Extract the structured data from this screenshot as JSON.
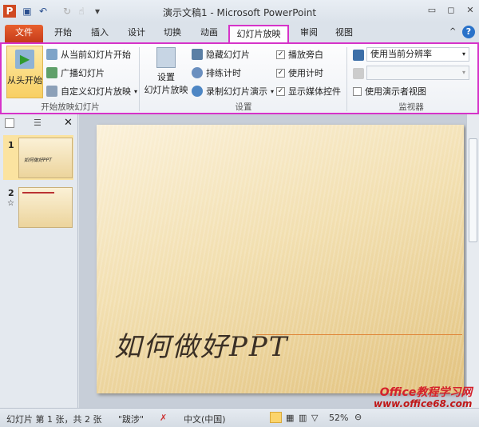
{
  "window": {
    "title": "演示文稿1 - Microsoft PowerPoint",
    "app_icon": "P"
  },
  "tabs": [
    {
      "label": "文件"
    },
    {
      "label": "开始"
    },
    {
      "label": "插入"
    },
    {
      "label": "设计"
    },
    {
      "label": "切换"
    },
    {
      "label": "动画"
    },
    {
      "label": "幻灯片放映",
      "active": true
    },
    {
      "label": "审阅"
    },
    {
      "label": "视图"
    }
  ],
  "ribbon": {
    "group1": {
      "label": "开始放映幻灯片",
      "from_start": "从头开始",
      "from_current": "从当前幻灯片开始",
      "broadcast": "广播幻灯片",
      "custom": "自定义幻灯片放映"
    },
    "group2": {
      "label": "设置",
      "setup_line1": "设置",
      "setup_line2": "幻灯片放映",
      "hide": "隐藏幻灯片",
      "rehearse": "排练计时",
      "record": "录制幻灯片演示",
      "narration": {
        "label": "播放旁白",
        "checked": true
      },
      "timings": {
        "label": "使用计时",
        "checked": true
      },
      "media": {
        "label": "显示媒体控件",
        "checked": true
      }
    },
    "group3": {
      "label": "监视器",
      "resolution": "使用当前分辨率",
      "monitor": "",
      "presenter": {
        "label": "使用演示者视图",
        "checked": false
      }
    }
  },
  "slides": [
    {
      "number": "1",
      "title": "如何做好PPT"
    },
    {
      "number": "2",
      "star": "☆"
    }
  ],
  "slide_title": "如何做好PPT",
  "status": {
    "slide": "幻灯片 第 1 张，共 2 张",
    "theme": "\"跋涉\"",
    "language": "中文(中国)",
    "zoom": "52%"
  },
  "watermark": {
    "line1": "Office教程学习网",
    "line2": "www.office68.com"
  },
  "colors": {
    "highlight": "#d633c9",
    "file_tab": "#d04a22"
  }
}
